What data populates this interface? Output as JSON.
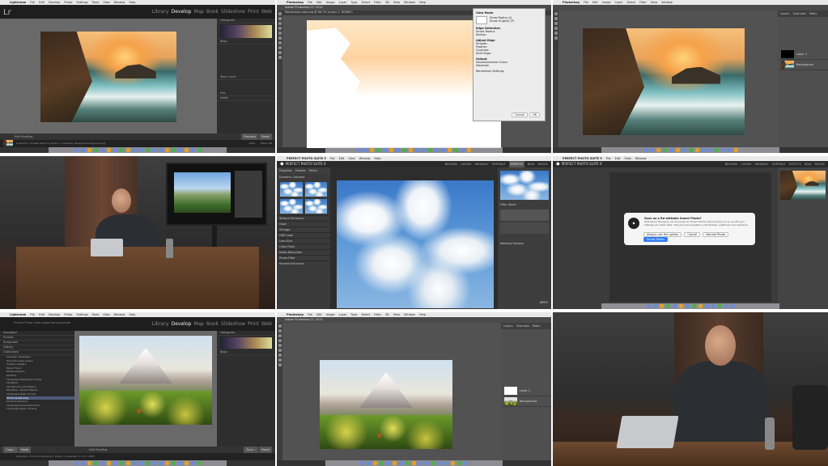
{
  "lightroom": {
    "mac_app": "Lightroom",
    "mac_menus": [
      "File",
      "Edit",
      "Develop",
      "Photo",
      "Settings",
      "Tools",
      "View",
      "Window",
      "Help"
    ],
    "logo": "Lr",
    "catalog_title": "Lightroom 5 Class.lrcat - Adobe Photoshop Lightroom - Develop",
    "modules": [
      "Library",
      "Develop",
      "Map",
      "Book",
      "Slideshow",
      "Print",
      "Web"
    ],
    "active_module": "Develop",
    "right_panels": [
      "Histogram",
      "Basic",
      "Tone Curve",
      "HSL",
      "Detail"
    ],
    "toolbar_text": "Soft Proofing",
    "buttons": [
      "Previous",
      "Reset"
    ],
    "film_info": "Collection: 33 Raw Export  1 photo / 1 selected / Reykjavik-foreground.jpg",
    "filter_label": "Filter:",
    "filter_value": "Filters Off"
  },
  "lightroom2": {
    "left_header": "Perfect Photo Suite exporting one photo",
    "left_panels": [
      "Navigator",
      "Presets",
      "Snapshots",
      "History",
      "Collections"
    ],
    "collections": [
      "Calendar Templates",
      "Hot Cuts Class Lesson",
      "Create a Gallery",
      "Mount Hood",
      "Mt Hood Books",
      "Portfolio",
      "Landscape Refinement Class",
      "LR Basics",
      "LR Instructor and Basics",
      "Workflow - Perfect Effects",
      "Landscape Basic Clones",
      "33 Focus Stacking",
      "Smart Collections",
      "Landscape Noise Reduction",
      "Landscape Basic Cloning"
    ],
    "buttons": [
      "Copy...",
      "Paste",
      "Sync...",
      "Reset"
    ],
    "toolbar_text": "Soft Proofing",
    "film_info": "Collection: 33 Focus Stacking  1 photo / 1 selected / 1 of 1 / 1087"
  },
  "photoshop": {
    "mac_app": "Photoshop",
    "mac_menus": [
      "File",
      "Edit",
      "Image",
      "Layer",
      "Type",
      "Select",
      "Filter",
      "3D",
      "View",
      "Window",
      "Help"
    ],
    "title": "Adobe Photoshop CC 2014",
    "doc_tab": "Replacesky-site.png @ 66.7% (Layer 1, RGB/8*)",
    "dialog": {
      "title": "Refine Edge",
      "sections": [
        "View Mode",
        "Edge Detection",
        "Adjust Edge",
        "Output"
      ],
      "checks": [
        "Show Radius (J)",
        "Show Original (P)",
        "Smart Radius",
        "Decontaminate Colors",
        "Remember Settings"
      ],
      "params": [
        "Radius:",
        "Smooth:",
        "Feather:",
        "Contrast:",
        "Shift Edge:"
      ],
      "output_to": "Selection",
      "cancel": "Cancel",
      "ok": "OK"
    },
    "layers_tabs": [
      "Layers",
      "Channels",
      "Paths"
    ],
    "layer_names": [
      "Layer 1",
      "Background"
    ]
  },
  "pps": {
    "brand": "PERFECT PHOTO SUITE 9",
    "nav": [
      "BROWSE",
      "LAYERS",
      "ENHANCE",
      "PORTRAIT",
      "EFFECTS",
      "B&W",
      "RESIZE"
    ],
    "active_nav": "EFFECTS",
    "left_tabs": [
      "Favorites",
      "Presets",
      "Filters"
    ],
    "presets": [
      "Dynamic Contrast",
      "Bump Contrast",
      "Soft",
      "Sunset Boost",
      "Texture Enhancer",
      "Glow",
      "Vintage",
      "HDR Look",
      "Lens Blur",
      "Color Fixes",
      "Noise Reduction",
      "Photo Filter",
      "Portrait Enhancer"
    ],
    "filter_stack": "Filter Stack",
    "masking": "Masking Options",
    "apply": "APPLY"
  },
  "smart_dialog": {
    "title": "Save as a Re-editable Smart Photo?",
    "body": "Photoshop file types can be saved as Smart Photos which allow you to re-edit your settings at a later date. They are still viewable in Photoshop, Lightroom and Aperture.",
    "options": [
      "Always use this option",
      "Cancel",
      "Normal Photo",
      "Smart Photo"
    ]
  },
  "colors": {
    "lr_bg": "#1e1e1e",
    "lr_canvas": "#696969",
    "ps_panel": "#4f4f4f",
    "accent_blue": "#2e7cf6"
  }
}
